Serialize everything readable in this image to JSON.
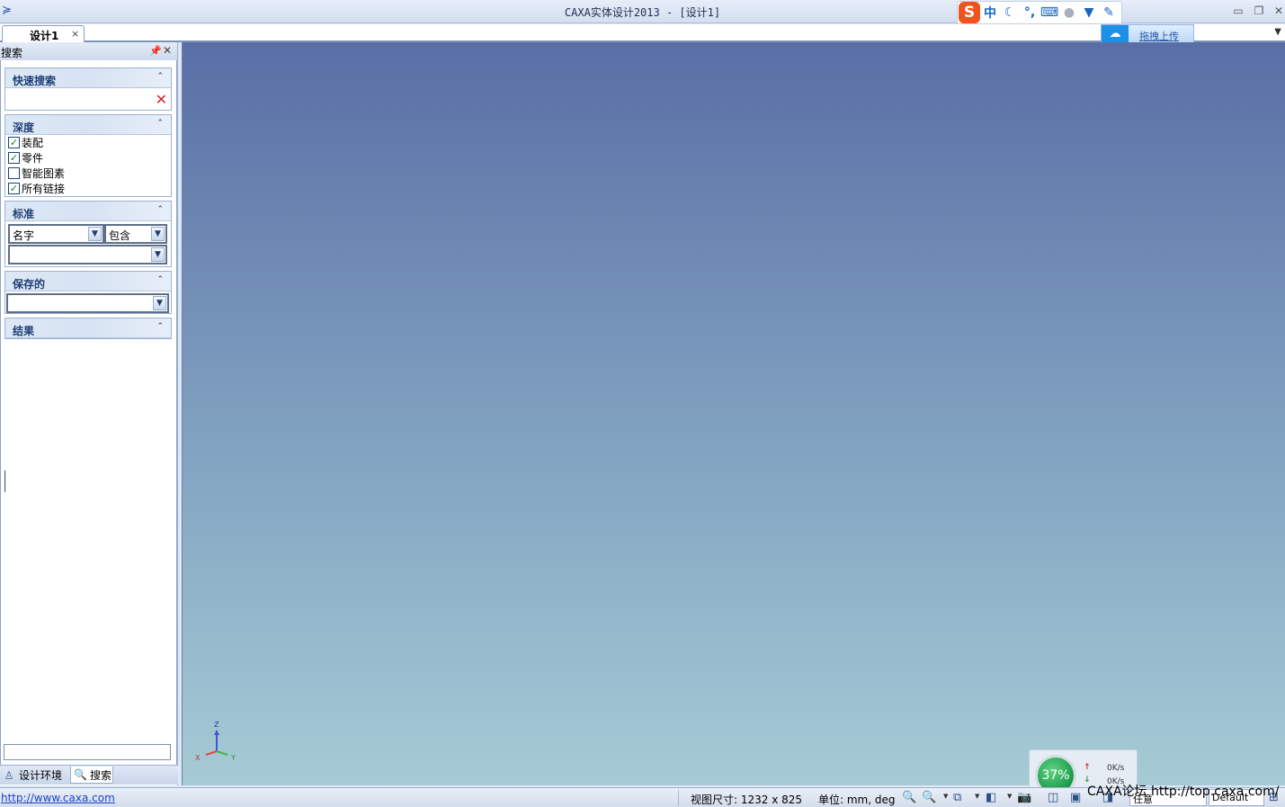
{
  "window": {
    "title": "CAXA实体设计2013 - [设计1]",
    "controls": {
      "minimize": "▭",
      "restore": "❐",
      "close": "✕"
    }
  },
  "ime": {
    "logo": "S",
    "mode": "中",
    "items": [
      "moon-icon",
      "punctuation-icon",
      "keyboard-icon",
      "user-icon",
      "skin-icon",
      "settings-icon"
    ]
  },
  "upload": {
    "label": "拖拽上传"
  },
  "tabs": [
    {
      "label": "设计1",
      "close": "×",
      "active": true
    }
  ],
  "panel": {
    "title": "搜索",
    "groups": {
      "quick_search": {
        "title": "快速搜索",
        "value": ""
      },
      "depth": {
        "title": "深度",
        "options": [
          {
            "label": "装配",
            "checked": true
          },
          {
            "label": "零件",
            "checked": true
          },
          {
            "label": "智能图素",
            "checked": false
          },
          {
            "label": "所有链接",
            "checked": true
          }
        ]
      },
      "criteria": {
        "title": "标准",
        "field": "名字",
        "operator": "包含",
        "value": ""
      },
      "saved": {
        "title": "保存的",
        "value": ""
      },
      "results": {
        "title": "结果"
      }
    },
    "bottom_tabs": [
      {
        "label": "设计环境",
        "icon": "design-env-icon"
      },
      {
        "label": "搜索",
        "icon": "search-icon",
        "active": true
      }
    ]
  },
  "viewport": {
    "axes": {
      "x": "X",
      "y": "Y",
      "z": "Z"
    }
  },
  "network": {
    "percent": "37%",
    "upload_rate": "0K/s",
    "download_rate": "0K/s"
  },
  "watermark": "CAXA论坛 http://top.caxa.com/",
  "status": {
    "link": "http://www.caxa.com",
    "view_size": "视图尺寸: 1232 x  825",
    "units": "单位: mm, deg",
    "mode": "任意",
    "scheme": "Default"
  },
  "colors": {
    "viewport_top": "#5a6ea6",
    "viewport_bottom": "#a6cbd5",
    "accent": "#1e3e75",
    "link": "#1c44c8"
  }
}
